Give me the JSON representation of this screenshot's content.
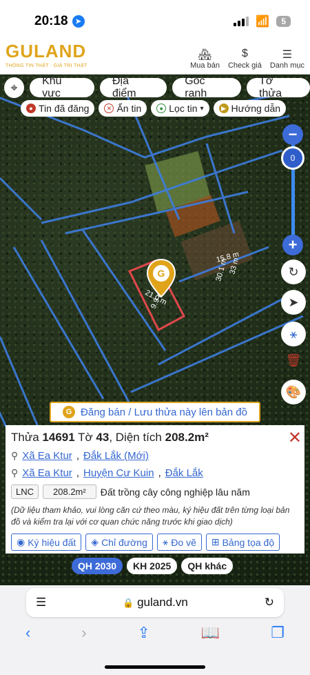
{
  "status": {
    "time": "20:18",
    "battery": "5"
  },
  "header": {
    "logo": "GULAND",
    "tagline": "THÔNG TIN THẬT · GIÁ TRỊ THẬT",
    "links": [
      {
        "label": "Mua bán",
        "icon": "building-icon"
      },
      {
        "label": "Check giá",
        "icon": "dollar-icon"
      },
      {
        "label": "Danh mục",
        "icon": "menu-icon"
      }
    ]
  },
  "toolbar": {
    "tabs": [
      "Khu vực",
      "Địa điểm",
      "Góc ranh",
      "Tờ thửa"
    ],
    "filters": [
      {
        "label": "Tin đã đăng",
        "color": "#c0392b"
      },
      {
        "label": "Ẩn tin",
        "color": "#c0392b"
      },
      {
        "label": "Lọc tin",
        "color": "#2e8b3d"
      },
      {
        "label": "Hướng dẫn",
        "color": "#c09a1b"
      }
    ]
  },
  "map": {
    "zoom_value": "0",
    "labels": {
      "dim1": "21.0 m",
      "dim2": "9.9 m",
      "dim3": "15.8 m",
      "dim4": "30.1 m",
      "dim5": "33 m"
    }
  },
  "cta": {
    "label": "Đăng bán / Lưu thửa này lên bản đồ"
  },
  "parcel": {
    "title_prefix": "Thửa",
    "parcel_no": "14691",
    "sheet_prefix": "Tờ",
    "sheet_no": "43",
    "area_label": ", Diện tích",
    "area": "208.2m²",
    "address_new": {
      "commune": "Xã Ea Ktur",
      "province": "Đắk Lắk (Mới)"
    },
    "address_old": {
      "commune": "Xã Ea Ktur",
      "district": "Huyện Cư Kuin",
      "province": "Đắk Lắk"
    },
    "land_code": "LNC",
    "land_area": "208.2m²",
    "land_desc": "Đất trồng cây công nghiệp lâu năm",
    "note": "(Dữ liệu tham khảo, vui lòng căn cứ theo màu, ký hiệu đất trên từng loại bản đồ và kiểm tra lại với cơ quan chức năng trước khi giao dịch)",
    "actions": [
      "Ký hiệu đất",
      "Chỉ đường",
      "Đo vẽ",
      "Bảng tọa độ"
    ]
  },
  "plan_tabs": [
    "QH 2030",
    "KH 2025",
    "QH khác"
  ],
  "browser": {
    "url": "guland.vn"
  }
}
